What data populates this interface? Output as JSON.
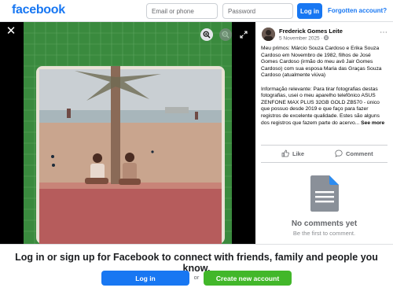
{
  "header": {
    "logo": "facebook",
    "email_placeholder": "Email or phone",
    "password_placeholder": "Password",
    "login_label": "Log in",
    "forgot_label": "Forgotten account?"
  },
  "post": {
    "author": "Frederick Gomes Leite",
    "date": "5 November 2025",
    "caption": "Meu primos: Márcio Souza Cardoso e Erika Souza Cardoso em Novembro de 1982, filhos de José Gomes Cardoso (irmão do meu avô Jair Gomes Cardoso) com sua esposa Maria das Graças Souza Cardoso (atualmente viúva)\n\nInformação relevante: Para tirar fotografias destas fotografias, usei o meu aparelho telefônico ASUS ZENFONE MAX PLUS 32GB GOLD ZB570 - único que possuo desde 2019 e que faço para fazer registros de excelente qualidade. Estes são alguns dos registros que fazem parte do acervo...",
    "see_more": "See more",
    "like_label": "Like",
    "comment_label": "Comment",
    "no_comments_title": "No comments yet",
    "no_comments_subtitle": "Be the first to comment."
  },
  "viewer": {
    "icons": [
      "close-icon",
      "zoom-in-icon",
      "zoom-out-icon",
      "expand-icon"
    ]
  },
  "signup": {
    "text": "Log in or sign up for Facebook to connect with friends, family and people you know.",
    "login_label": "Log in",
    "or_label": "or",
    "create_label": "Create new account"
  },
  "colors": {
    "brand": "#1877f2",
    "create": "#42b72a",
    "text_primary": "#050505",
    "text_secondary": "#65676b"
  }
}
